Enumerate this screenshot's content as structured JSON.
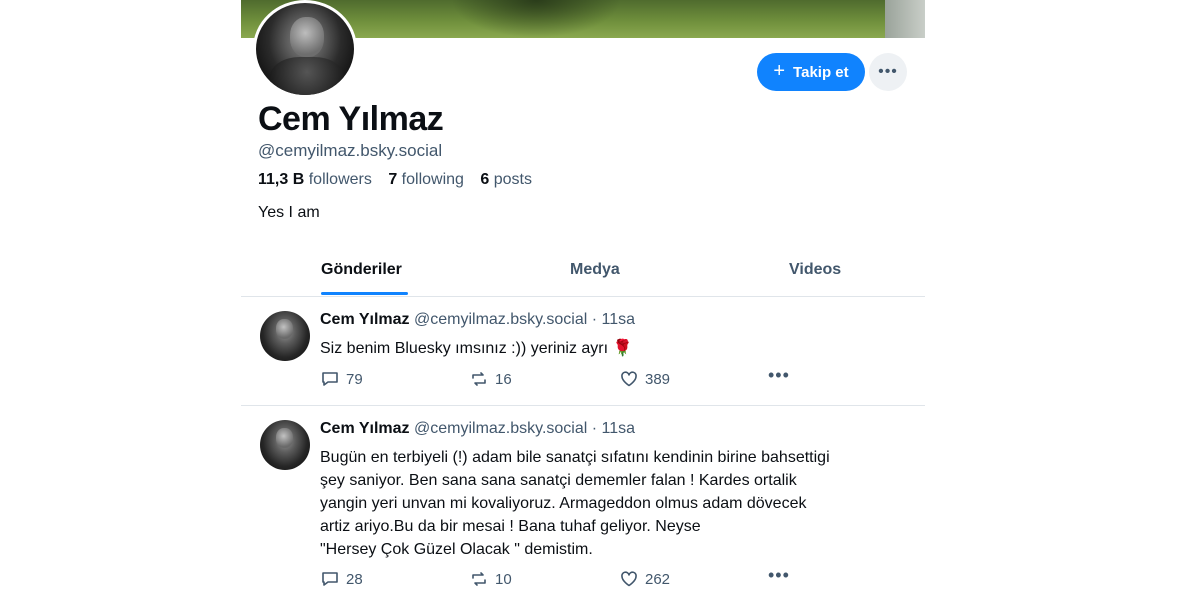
{
  "profile": {
    "display_name": "Cem Yılmaz",
    "handle": "@cemyilmaz.bsky.social",
    "followers_count": "11,3 B",
    "followers_label": "followers",
    "following_count": "7",
    "following_label": "following",
    "posts_count": "6",
    "posts_label": "posts",
    "bio": "Yes I am"
  },
  "actions": {
    "follow_label": "Takip et",
    "follow_icon": "plus-icon",
    "more_icon": "more-icon",
    "accent_color": "#1083fe"
  },
  "tabs": [
    {
      "label": "Gönderiler",
      "active": true
    },
    {
      "label": "Medya",
      "active": false
    },
    {
      "label": "Videos",
      "active": false
    }
  ],
  "posts": [
    {
      "author": "Cem Yılmaz",
      "handle": "@cemyilmaz.bsky.social",
      "time": "· 11sa",
      "text": "Siz benim Bluesky ımsınız :)) yeriniz ayrı 🌹",
      "replies": "79",
      "reposts": "16",
      "likes": "389"
    },
    {
      "author": "Cem Yılmaz",
      "handle": "@cemyilmaz.bsky.social",
      "time": "· 11sa",
      "text": "Bugün en terbiyeli (!) adam bile sanatçi sıfatını kendinin birine bahsettigi\nşey saniyor. Ben sana sana sanatçi dememler falan ! Kardes ortalik\nyangin yeri unvan mi kovaliyoruz. Armageddon olmus adam dövecek\nartiz ariyo.Bu da bir mesai ! Bana tuhaf geliyor. Neyse\n\"Hersey Çok Güzel Olacak \" demistim.",
      "replies": "28",
      "reposts": "10",
      "likes": "262"
    }
  ]
}
